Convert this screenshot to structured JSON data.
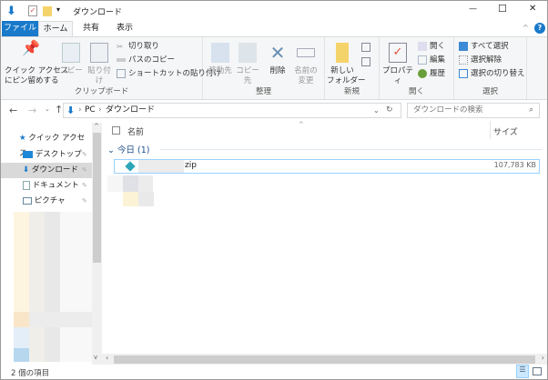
{
  "window": {
    "title": "ダウンロード",
    "minimize": "—",
    "maximize": "☐",
    "close": "✕"
  },
  "tabs": [
    {
      "label": "ファイル"
    },
    {
      "label": "ホーム"
    },
    {
      "label": "共有"
    },
    {
      "label": "表示"
    }
  ],
  "ribbon": {
    "clipboard": {
      "label": "クリップボード",
      "pin": "クイック アクセス\nにピン留めする",
      "copy": "コピー",
      "paste": "貼り付け",
      "cut": "切り取り",
      "copy_path": "パスのコピー",
      "paste_shortcut": "ショートカットの貼り付け"
    },
    "organize": {
      "label": "整理",
      "move_to": "移動先",
      "copy_to": "コピー先",
      "delete": "削除",
      "rename": "名前の\n変更"
    },
    "new": {
      "label": "新規",
      "new_folder": "新しい\nフォルダー"
    },
    "open": {
      "label": "開く",
      "properties": "プロパティ",
      "open": "開く",
      "edit": "編集",
      "history": "履歴"
    },
    "select": {
      "label": "選択",
      "select_all": "すべて選択",
      "select_none": "選択解除",
      "invert": "選択の切り替え"
    }
  },
  "address": {
    "path": [
      "PC",
      "ダウンロード"
    ],
    "search_placeholder": "ダウンロードの検索"
  },
  "nav": {
    "quick_access": "クイック アクセス",
    "items": [
      {
        "label": "デスクトップ"
      },
      {
        "label": "ダウンロード"
      },
      {
        "label": "ドキュメント"
      },
      {
        "label": "ピクチャ"
      }
    ]
  },
  "list": {
    "col_name": "名前",
    "col_size": "サイズ",
    "group": "今日 (1)",
    "files": [
      {
        "name": "zip",
        "size": "107,783 KB"
      }
    ]
  },
  "status": {
    "count": "2 個の項目"
  },
  "colors": {
    "accent": "#1979ca",
    "selected": "#cce8ff"
  }
}
